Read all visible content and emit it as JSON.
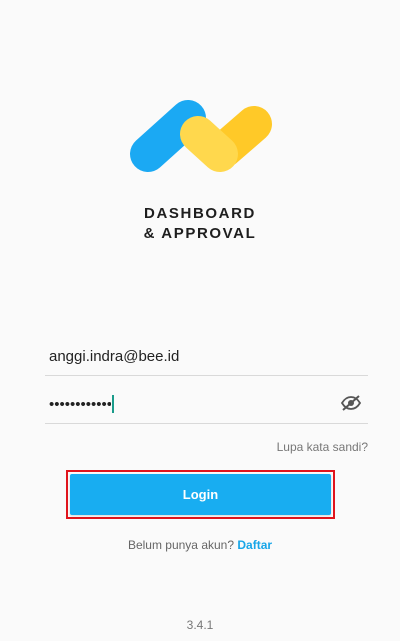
{
  "brand": {
    "line1": "DASHBOARD",
    "line2": "& APPROVAL",
    "logo_colors": {
      "blue": "#1ba9f3",
      "yellow_dark": "#ffc928",
      "yellow_light": "#ffd84d"
    }
  },
  "login_form": {
    "email_value": "anggi.indra@bee.id",
    "password_value": "••••••••••••",
    "toggle_visibility_icon": "eye-off-icon",
    "forgot_password_label": "Lupa kata sandi?",
    "login_label": "Login",
    "login_button_color": "#18adf1",
    "highlight_color": "#e0141c"
  },
  "register": {
    "prompt": "Belum punya akun?",
    "link_label": "Daftar"
  },
  "version": "3.4.1"
}
